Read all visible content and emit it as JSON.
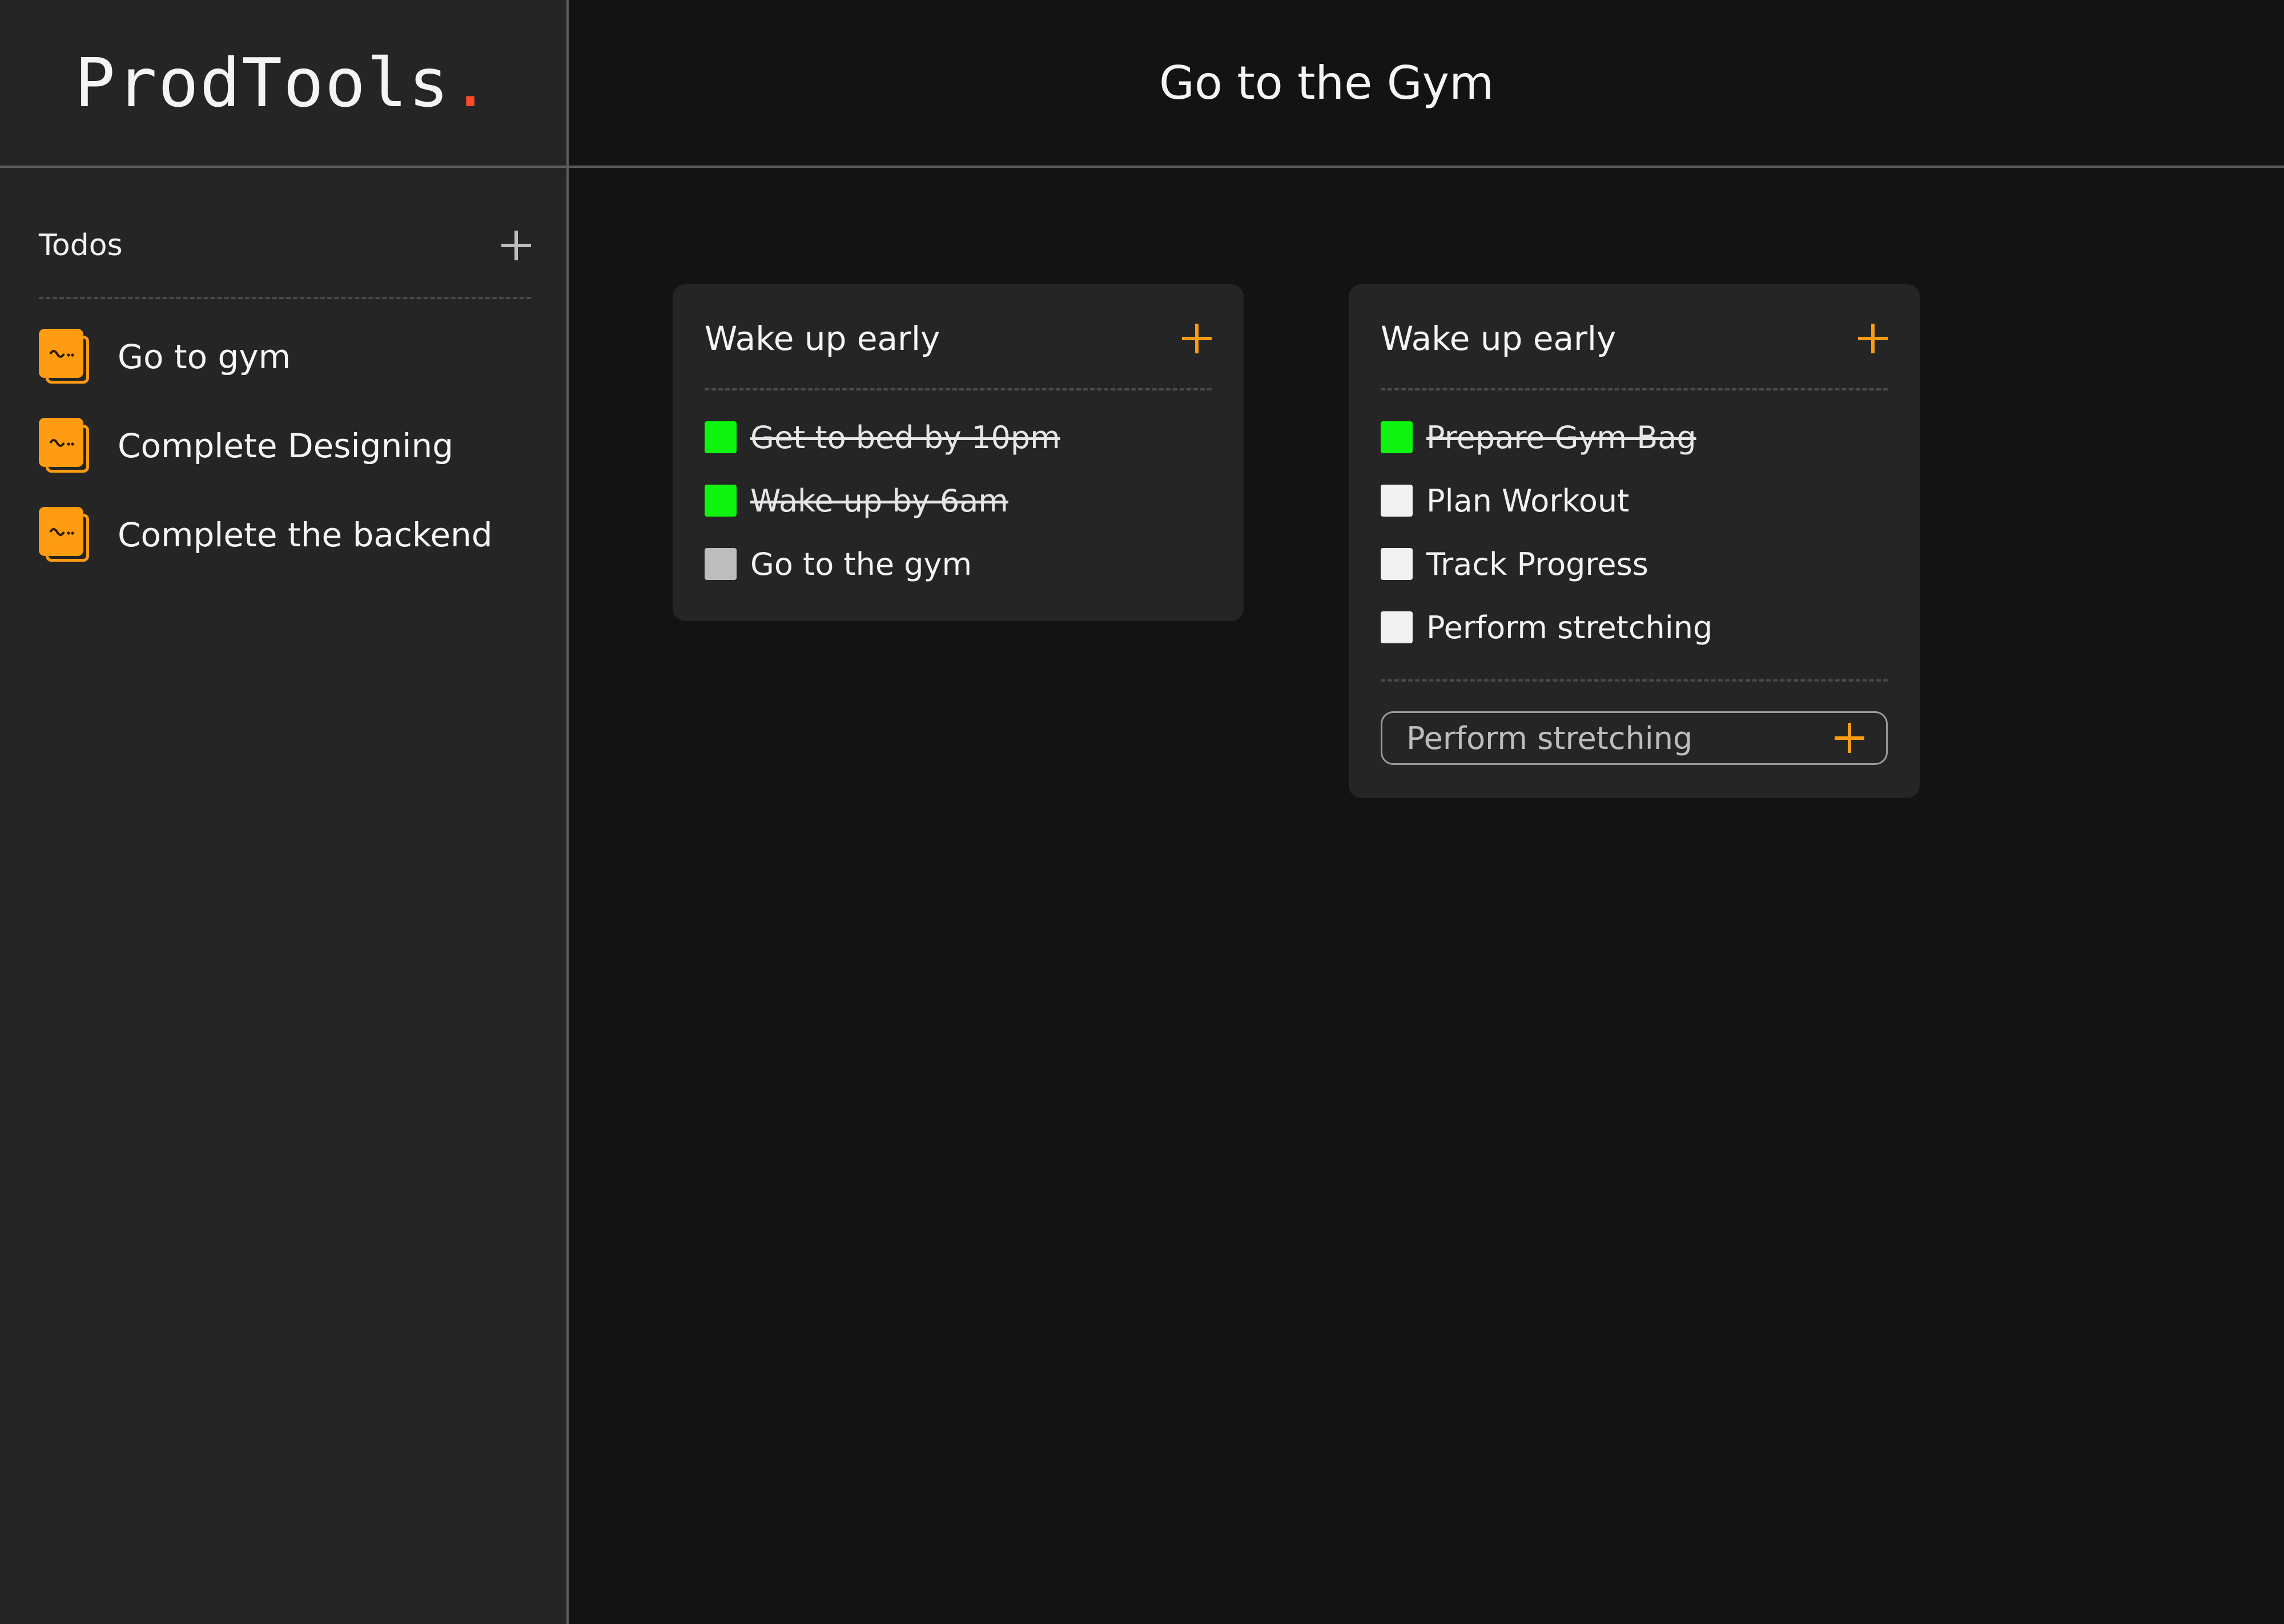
{
  "app": {
    "logo_text": "ProdTools",
    "logo_dot": "."
  },
  "sidebar": {
    "section_title": "Todos",
    "add_icon": "plus-icon",
    "items": [
      {
        "label": "Go to gym",
        "icon": "note-icon"
      },
      {
        "label": "Complete Designing",
        "icon": "note-icon"
      },
      {
        "label": "Complete the backend",
        "icon": "note-icon"
      }
    ]
  },
  "main": {
    "title": "Go to the Gym",
    "cards": [
      {
        "title": "Wake up early",
        "items": [
          {
            "label": "Get to bed by 10pm",
            "done": true
          },
          {
            "label": "Wake up by 6am",
            "done": true
          },
          {
            "label": "Go to the gym",
            "done": false
          }
        ]
      },
      {
        "title": "Wake up early",
        "items": [
          {
            "label": "Prepare Gym Bag",
            "done": true
          },
          {
            "label": "Plan Workout",
            "done": false
          },
          {
            "label": "Track Progress",
            "done": false
          },
          {
            "label": "Perform stretching",
            "done": false
          }
        ],
        "new_item_value": "Perform stretching"
      }
    ]
  },
  "colors": {
    "accent": "#ff9c12",
    "done": "#0ef40e",
    "logo_dot": "#ff4a2a",
    "background": "#131313",
    "panel": "#252525"
  }
}
